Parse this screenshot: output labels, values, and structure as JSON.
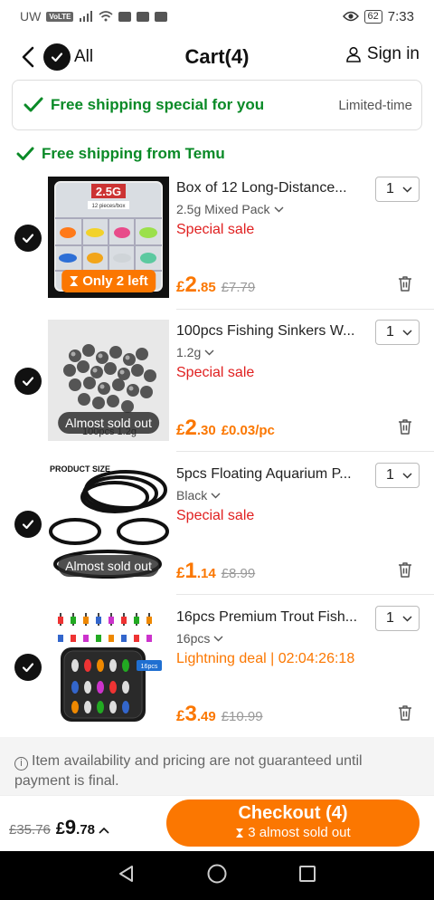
{
  "status_bar": {
    "carrier": "UW",
    "volte": "VoLTE",
    "battery": "62",
    "time": "7:33"
  },
  "header": {
    "all_label": "All",
    "title": "Cart(4)",
    "sign_in": "Sign in"
  },
  "promo": {
    "text": "Free shipping special for you",
    "limited": "Limited-time"
  },
  "shipping_from": "Free shipping from Temu",
  "items": [
    {
      "name": "Box of 12 Long-Distance...",
      "variant": "2.5g Mixed Pack",
      "tag": "Special sale",
      "qty": "1",
      "badge": "Only 2 left",
      "price_cur": "£",
      "price_int": "2",
      "price_dec": ".85",
      "price_old": "£7.79",
      "price_unit": "",
      "box_label": "2.5G",
      "box_sub": "12 pieces/box"
    },
    {
      "name": "100pcs Fishing Sinkers W...",
      "variant": "1.2g",
      "tag": "Special sale",
      "qty": "1",
      "badge": "Almost sold out",
      "price_cur": "£",
      "price_int": "2",
      "price_dec": ".30",
      "price_old": "",
      "price_unit": "£0.03/pc",
      "img_caption": "100pcs 1.2g"
    },
    {
      "name": "5pcs Floating Aquarium P...",
      "variant": "Black",
      "tag": "Special sale",
      "qty": "1",
      "badge": "Almost sold out",
      "price_cur": "£",
      "price_int": "1",
      "price_dec": ".14",
      "price_old": "£8.99",
      "price_unit": "",
      "img_caption": "PRODUCT SIZE"
    },
    {
      "name": "16pcs Premium Trout Fish...",
      "variant": "16pcs",
      "tag": "Lightning deal | 02:04:26:18",
      "qty": "1",
      "badge": "",
      "price_cur": "£",
      "price_int": "3",
      "price_dec": ".49",
      "price_old": "£10.99",
      "price_unit": "",
      "img_caption": "16pcs"
    }
  ],
  "notice": "Item availability and pricing are not guaranteed until payment is final.",
  "footer": {
    "original_total": "£35.76",
    "total_cur": "£",
    "total_int": "9",
    "total_dec": ".78",
    "checkout_label": "Checkout (4)",
    "checkout_sub": "3 almost sold out"
  },
  "colors": {
    "accent": "#fb7701",
    "green": "#0a8a27",
    "sale_red": "#e02020"
  }
}
